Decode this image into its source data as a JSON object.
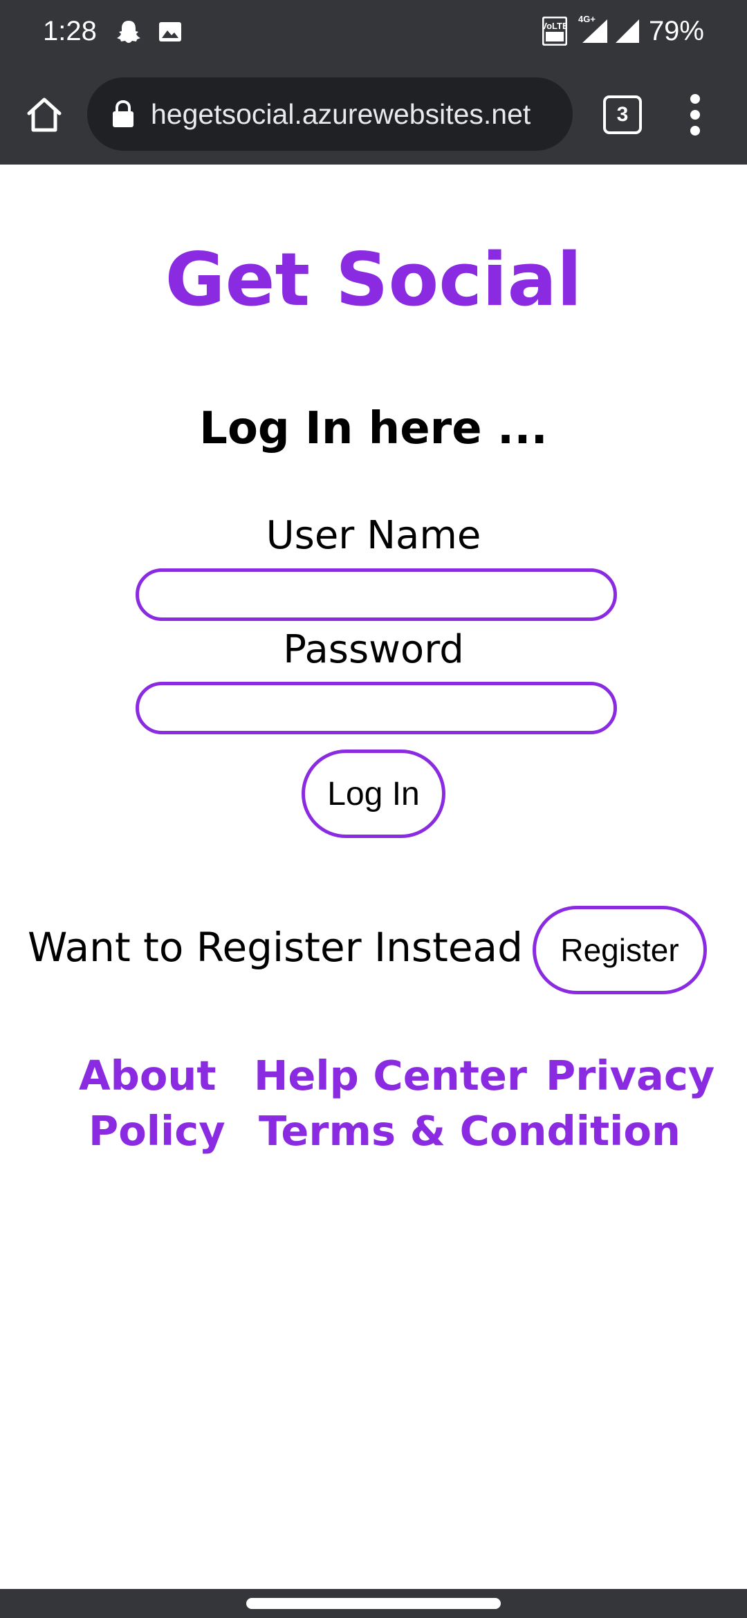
{
  "status_bar": {
    "time": "1:28",
    "notification_icons": [
      "snapchat-icon",
      "image-icon"
    ],
    "system_icons": [
      "volte-icon",
      "signal-4g-icon",
      "signal-icon"
    ],
    "network_label": "4G+",
    "volte_label": "VoLTE",
    "battery": "79%"
  },
  "browser": {
    "url": "hegetsocial.azurewebsites.net",
    "tab_count": "3",
    "icons": [
      "home-icon",
      "lock-icon",
      "tabs-icon",
      "more-vert-icon"
    ]
  },
  "page": {
    "title": "Get Social",
    "login_heading": "Log In here ...",
    "username_label": "User Name",
    "username_value": "",
    "password_label": "Password",
    "password_value": "",
    "login_button": "Log In",
    "register_prompt": "Want to Register Instead ?",
    "register_button": "Register"
  },
  "footer": {
    "links": [
      "About",
      "Help Center",
      "Privacy Policy",
      "Terms & Condition"
    ],
    "privacy_line1": "Privacy",
    "privacy_line2": "Policy"
  },
  "colors": {
    "accent": "#8a2be2",
    "chrome_dark": "#35363a",
    "url_pill": "#202124",
    "text": "#000000",
    "background": "#ffffff"
  }
}
